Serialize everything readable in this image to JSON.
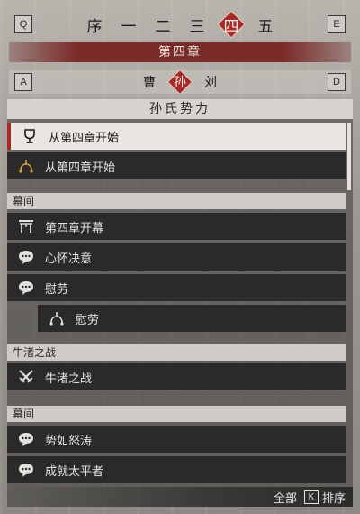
{
  "chapter_nav": {
    "prev_key": "Q",
    "next_key": "E",
    "tabs": [
      "序",
      "一",
      "二",
      "三",
      "四",
      "五"
    ],
    "active_index": 4
  },
  "chapter_title": "第四章",
  "faction_nav": {
    "prev_key": "A",
    "next_key": "D",
    "tabs": [
      "曹",
      "孙",
      "刘"
    ],
    "active_index": 1
  },
  "panel": {
    "title": "孙氏势力",
    "items": [
      {
        "label": "从第四章开始",
        "icon": "trophy-icon",
        "selected": true
      },
      {
        "label": "从第四章开始",
        "icon": "branch-icon",
        "selected": false
      }
    ],
    "sections": [
      {
        "header": "幕间",
        "items": [
          {
            "label": "第四章开幕",
            "icon": "gate-icon"
          },
          {
            "label": "心怀决意",
            "icon": "dialogue-icon"
          },
          {
            "label": "慰劳",
            "icon": "dialogue-icon"
          },
          {
            "label": "慰劳",
            "icon": "branch-icon",
            "indent": true
          }
        ]
      },
      {
        "header": "牛渚之战",
        "items": [
          {
            "label": "牛渚之战",
            "icon": "crossed-swords-icon"
          }
        ]
      },
      {
        "header": "幕间",
        "items": [
          {
            "label": "势如怒涛",
            "icon": "dialogue-icon"
          },
          {
            "label": "成就太平者",
            "icon": "dialogue-icon"
          }
        ]
      }
    ],
    "footer": {
      "filter_label": "全部",
      "sort_key": "K",
      "sort_label": "排序"
    }
  },
  "colors": {
    "accent_red": "#a62b28",
    "row_dark": "#2a2a2a",
    "row_selected": "#e9e6e2"
  }
}
